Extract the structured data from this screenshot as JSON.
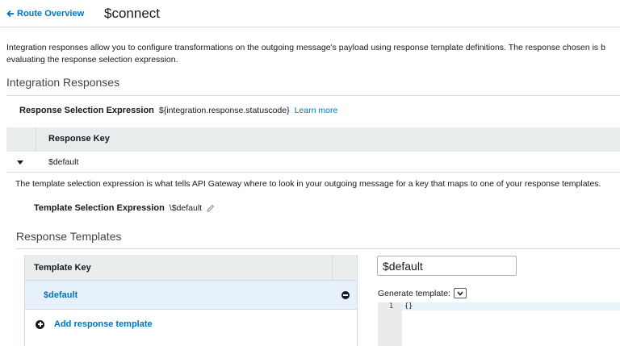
{
  "header": {
    "back_label": "Route Overview",
    "title": "$connect"
  },
  "intro": {
    "line1": "Integration responses allow you to configure transformations on the outgoing message's payload using response template definitions. The response chosen is b",
    "line2": "evaluating the response selection expression."
  },
  "integration_responses": {
    "heading": "Integration Responses",
    "selection_label": "Response Selection Expression",
    "selection_value": "${integration.response.statuscode}",
    "learn_more": "Learn more",
    "table_header": "Response Key",
    "rows": [
      {
        "key": "$default"
      }
    ]
  },
  "template_info": {
    "description": "The template selection expression is what tells API Gateway where to look in your outgoing message for a key that maps to one of your response templates.",
    "expression_label": "Template Selection Expression",
    "expression_value": "\\$default"
  },
  "response_templates": {
    "heading": "Response Templates",
    "table_header": "Template Key",
    "rows": [
      {
        "key": "$default"
      }
    ],
    "add_label": "Add response template",
    "key_input_value": "$default",
    "generate_label": "Generate template:",
    "editor": {
      "line_number": "1",
      "content": "{}"
    }
  },
  "colors": {
    "link": "#0073bb",
    "table_header_bg": "#eaeded",
    "selected_row_bg": "#e6f1fb",
    "border": "#d5dbdb"
  }
}
